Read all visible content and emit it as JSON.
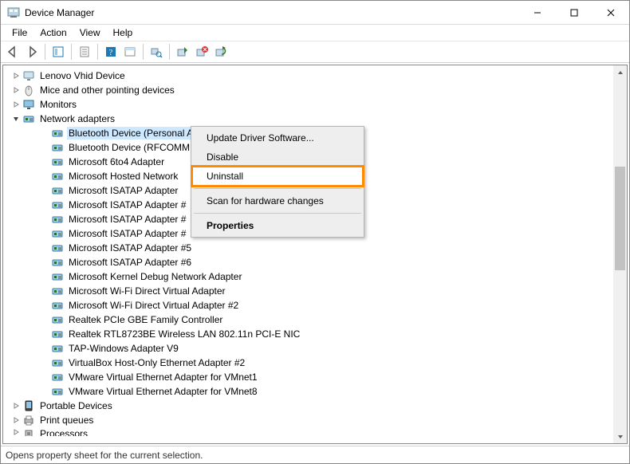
{
  "window": {
    "title": "Device Manager"
  },
  "menu": {
    "items": [
      "File",
      "Action",
      "View",
      "Help"
    ]
  },
  "toolbar": {
    "icons": [
      "back-icon",
      "forward-icon",
      "|",
      "show-hide-tree-icon",
      "|",
      "properties-icon",
      "|",
      "help-icon",
      "legacy-icon",
      "|",
      "scan-hardware-icon",
      "|",
      "update-driver-icon",
      "uninstall-icon",
      "refresh-icon"
    ]
  },
  "tree": {
    "nodes": [
      {
        "icon": "device",
        "label": "Lenovo Vhid Device",
        "expandable": true,
        "expanded": false
      },
      {
        "icon": "mouse",
        "label": "Mice and other pointing devices",
        "expandable": true,
        "expanded": false
      },
      {
        "icon": "monitor",
        "label": "Monitors",
        "expandable": true,
        "expanded": false
      },
      {
        "icon": "network",
        "label": "Network adapters",
        "expandable": true,
        "expanded": true,
        "children": [
          {
            "label": "Bluetooth Device (Personal Area Network)",
            "selected": true
          },
          {
            "label": "Bluetooth Device (RFCOMM"
          },
          {
            "label": "Microsoft 6to4 Adapter"
          },
          {
            "label": "Microsoft Hosted Network"
          },
          {
            "label": "Microsoft ISATAP Adapter"
          },
          {
            "label": "Microsoft ISATAP Adapter #"
          },
          {
            "label": "Microsoft ISATAP Adapter #"
          },
          {
            "label": "Microsoft ISATAP Adapter #"
          },
          {
            "label": "Microsoft ISATAP Adapter #5"
          },
          {
            "label": "Microsoft ISATAP Adapter #6"
          },
          {
            "label": "Microsoft Kernel Debug Network Adapter"
          },
          {
            "label": "Microsoft Wi-Fi Direct Virtual Adapter"
          },
          {
            "label": "Microsoft Wi-Fi Direct Virtual Adapter #2"
          },
          {
            "label": "Realtek PCIe GBE Family Controller"
          },
          {
            "label": "Realtek RTL8723BE Wireless LAN 802.11n PCI-E NIC"
          },
          {
            "label": "TAP-Windows Adapter V9"
          },
          {
            "label": "VirtualBox Host-Only Ethernet Adapter #2"
          },
          {
            "label": "VMware Virtual Ethernet Adapter for VMnet1"
          },
          {
            "label": "VMware Virtual Ethernet Adapter for VMnet8"
          }
        ]
      },
      {
        "icon": "portable",
        "label": "Portable Devices",
        "expandable": true,
        "expanded": false
      },
      {
        "icon": "printer",
        "label": "Print queues",
        "expandable": true,
        "expanded": false
      },
      {
        "icon": "cpu",
        "label": "Processors",
        "expandable": true,
        "expanded": false,
        "cut": true
      }
    ]
  },
  "context_menu": {
    "items": [
      {
        "label": "Update Driver Software...",
        "type": "item"
      },
      {
        "label": "Disable",
        "type": "item"
      },
      {
        "label": "Uninstall",
        "type": "item",
        "highlight": true
      },
      {
        "type": "sep"
      },
      {
        "label": "Scan for hardware changes",
        "type": "item"
      },
      {
        "type": "sep"
      },
      {
        "label": "Properties",
        "type": "item",
        "bold": true
      }
    ]
  },
  "statusbar": {
    "text": "Opens property sheet for the current selection."
  }
}
